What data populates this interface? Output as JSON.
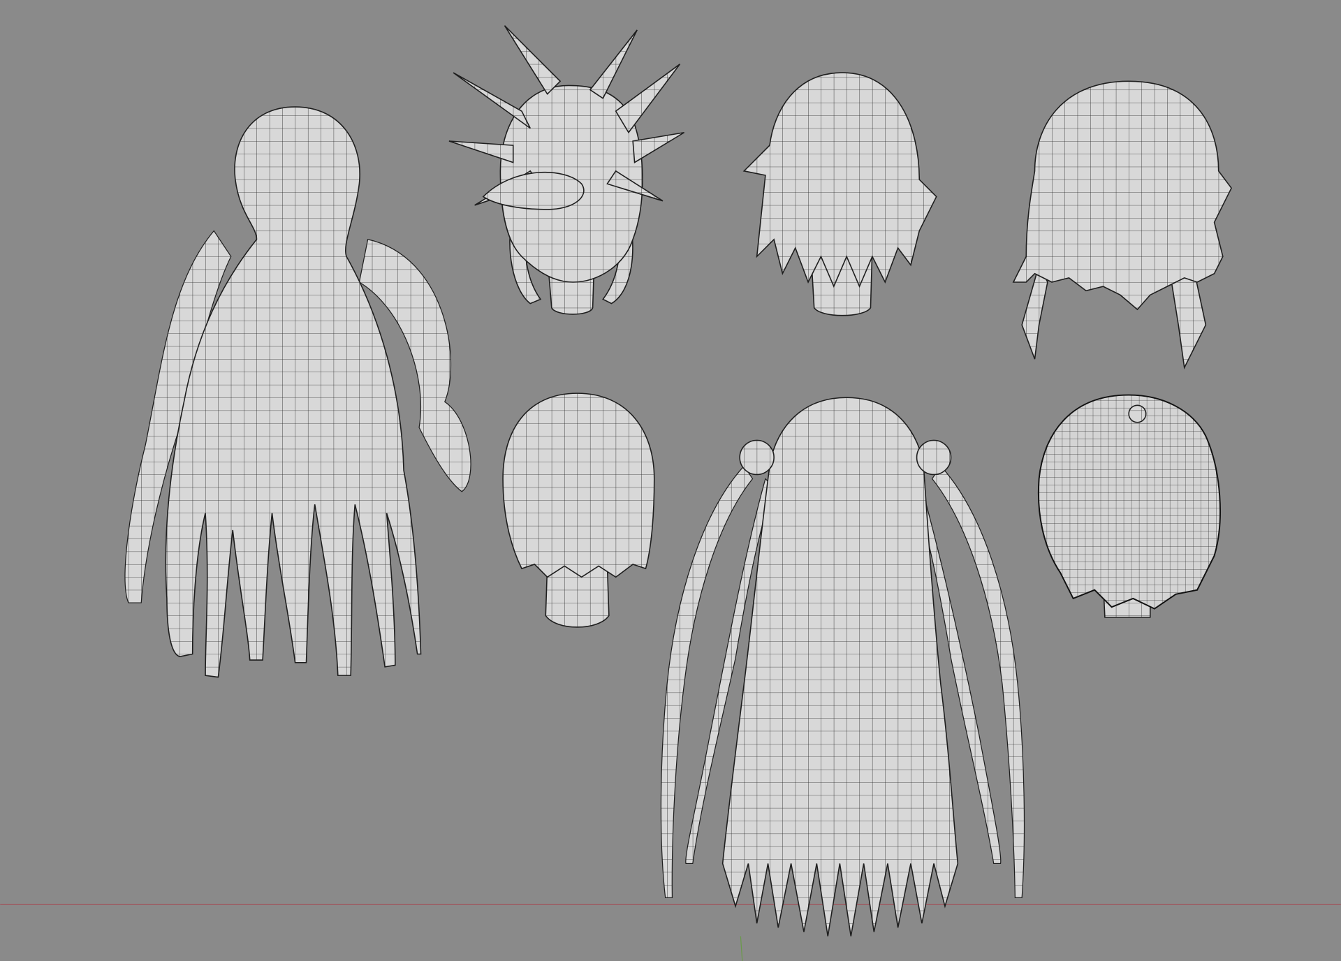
{
  "viewport": {
    "background_color": "#8a8a8a",
    "mesh_color": "#d8d8d8",
    "wire_color": "#1e1e1e",
    "x_axis_color": "#a0525a",
    "y_axis_color": "#6a9a4a"
  },
  "objects": [
    "tentacle-hair-mesh",
    "spiky-hair-mesh",
    "layered-short-hair-mesh",
    "bob-hair-mesh",
    "round-head-hair-mesh",
    "twintail-long-hair-mesh",
    "leaf-hair-mesh"
  ]
}
